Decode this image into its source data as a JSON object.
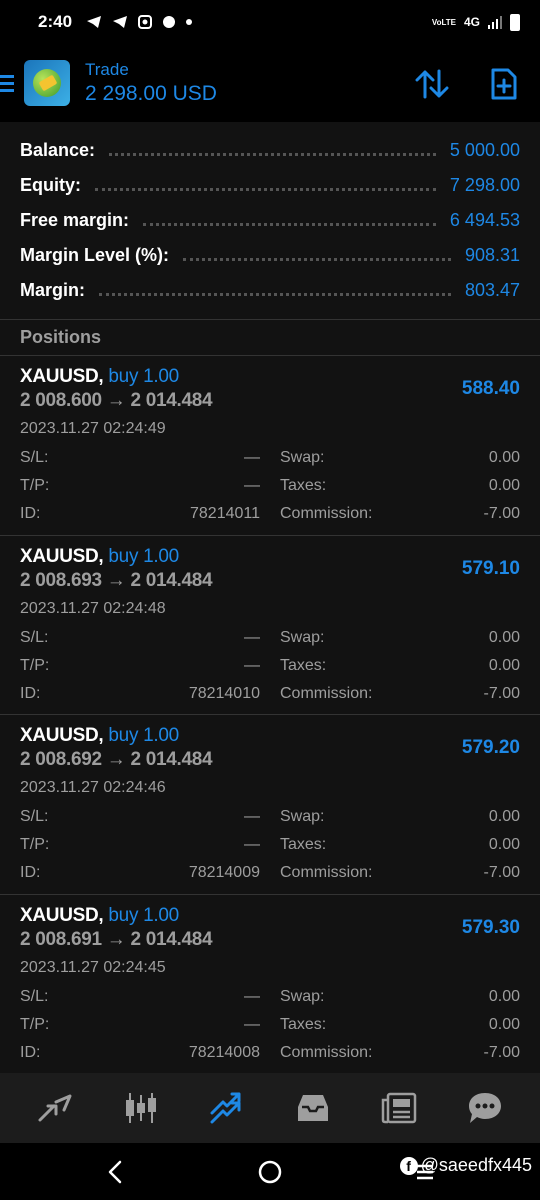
{
  "status_bar": {
    "time": "2:40",
    "network": "4G",
    "volte": "VoLTE"
  },
  "header": {
    "title": "Trade",
    "subtitle": "2 298.00 USD"
  },
  "summary": {
    "rows": [
      {
        "label": "Balance:",
        "value": "5 000.00"
      },
      {
        "label": "Equity:",
        "value": "7 298.00"
      },
      {
        "label": "Free margin:",
        "value": "6 494.53"
      },
      {
        "label": "Margin Level (%):",
        "value": "908.31"
      },
      {
        "label": "Margin:",
        "value": "803.47"
      }
    ]
  },
  "positions_header": "Positions",
  "positions": [
    {
      "symbol": "XAUUSD,",
      "type": "buy 1.00",
      "prices": "2 008.600 → 2 014.484",
      "profit": "588.40",
      "time": "2023.11.27 02:24:49",
      "sl_label": "S/L:",
      "sl": "—",
      "tp_label": "T/P:",
      "tp": "—",
      "id_label": "ID:",
      "id": "78214011",
      "swap_label": "Swap:",
      "swap": "0.00",
      "taxes_label": "Taxes:",
      "taxes": "0.00",
      "commission_label": "Commission:",
      "commission": "-7.00"
    },
    {
      "symbol": "XAUUSD,",
      "type": "buy 1.00",
      "prices": "2 008.693 → 2 014.484",
      "profit": "579.10",
      "time": "2023.11.27 02:24:48",
      "sl_label": "S/L:",
      "sl": "—",
      "tp_label": "T/P:",
      "tp": "—",
      "id_label": "ID:",
      "id": "78214010",
      "swap_label": "Swap:",
      "swap": "0.00",
      "taxes_label": "Taxes:",
      "taxes": "0.00",
      "commission_label": "Commission:",
      "commission": "-7.00"
    },
    {
      "symbol": "XAUUSD,",
      "type": "buy 1.00",
      "prices": "2 008.692 → 2 014.484",
      "profit": "579.20",
      "time": "2023.11.27 02:24:46",
      "sl_label": "S/L:",
      "sl": "—",
      "tp_label": "T/P:",
      "tp": "—",
      "id_label": "ID:",
      "id": "78214009",
      "swap_label": "Swap:",
      "swap": "0.00",
      "taxes_label": "Taxes:",
      "taxes": "0.00",
      "commission_label": "Commission:",
      "commission": "-7.00"
    },
    {
      "symbol": "XAUUSD,",
      "type": "buy 1.00",
      "prices": "2 008.691 → 2 014.484",
      "profit": "579.30",
      "time": "2023.11.27 02:24:45",
      "sl_label": "S/L:",
      "sl": "—",
      "tp_label": "T/P:",
      "tp": "—",
      "id_label": "ID:",
      "id": "78214008",
      "swap_label": "Swap:",
      "swap": "0.00",
      "taxes_label": "Taxes:",
      "taxes": "0.00",
      "commission_label": "Commission:",
      "commission": "-7.00"
    }
  ],
  "bottom_nav": {
    "items": [
      "quotes-icon",
      "chart-icon",
      "trade-icon",
      "history-icon",
      "news-icon",
      "chat-icon"
    ],
    "active": "trade-icon"
  },
  "watermark": "@saeedfx445",
  "colors": {
    "accent": "#1e88e5",
    "background": "#121212",
    "muted": "#9e9e9e"
  }
}
